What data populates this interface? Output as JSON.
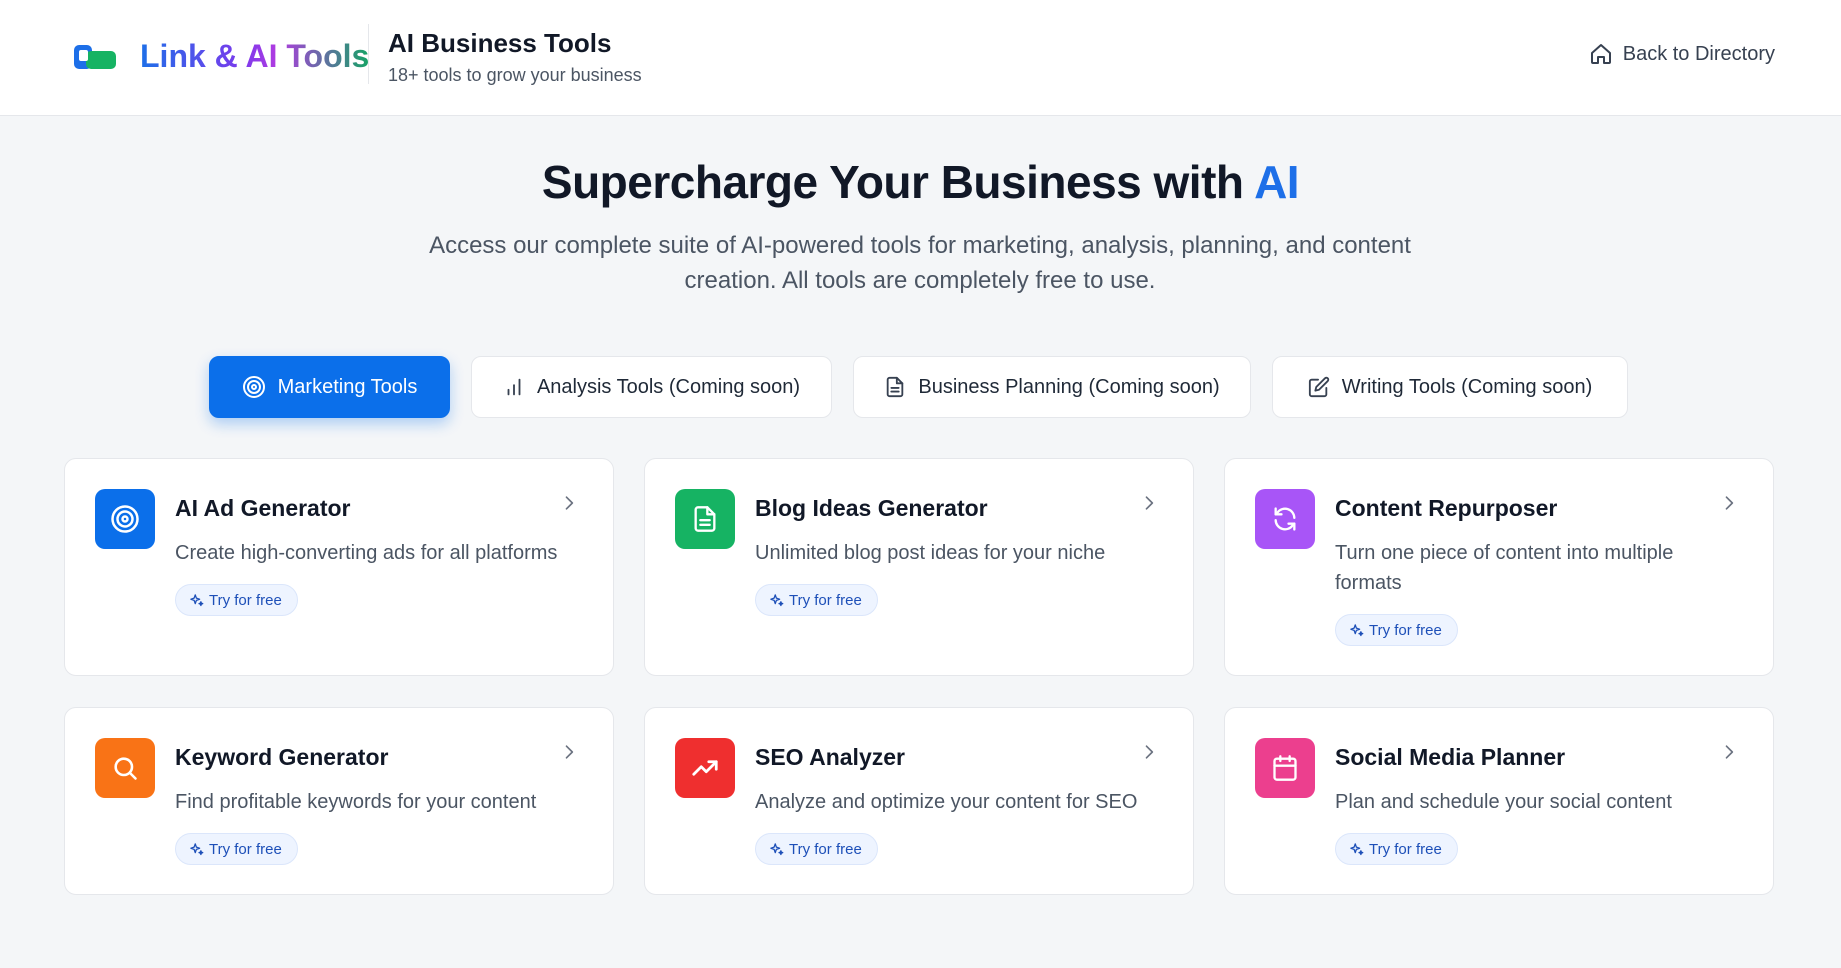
{
  "header": {
    "brand": "Link & AI Tools",
    "title": "AI Business Tools",
    "subtitle": "18+ tools to grow your business",
    "back_label": "Back to Directory"
  },
  "hero": {
    "title_main": "Supercharge Your Business with ",
    "title_accent": "AI",
    "description": "Access our complete suite of AI-powered tools for marketing, analysis, planning, and content creation. All tools are completely free to use."
  },
  "tabs": [
    {
      "label": "Marketing Tools",
      "icon": "target-icon",
      "active": true
    },
    {
      "label": "Analysis Tools (Coming soon)",
      "icon": "bar-chart-icon",
      "active": false
    },
    {
      "label": "Business Planning (Coming soon)",
      "icon": "document-icon",
      "active": false
    },
    {
      "label": "Writing Tools (Coming soon)",
      "icon": "edit-icon",
      "active": false
    }
  ],
  "tools": [
    {
      "title": "AI Ad Generator",
      "description": "Create high-converting ads for all platforms",
      "cta": "Try for free",
      "icon": "target-icon",
      "color": "#0b6fea"
    },
    {
      "title": "Blog Ideas Generator",
      "description": "Unlimited blog post ideas for your niche",
      "cta": "Try for free",
      "icon": "document-icon",
      "color": "#16b363"
    },
    {
      "title": "Content Repurposer",
      "description": "Turn one piece of content into multiple formats",
      "cta": "Try for free",
      "icon": "refresh-icon",
      "color": "#a855f7"
    },
    {
      "title": "Keyword Generator",
      "description": "Find profitable keywords for your content",
      "cta": "Try for free",
      "icon": "search-icon",
      "color": "#f97316"
    },
    {
      "title": "SEO Analyzer",
      "description": "Analyze and optimize your content for SEO",
      "cta": "Try for free",
      "icon": "trending-up-icon",
      "color": "#ef2f2f"
    },
    {
      "title": "Social Media Planner",
      "description": "Plan and schedule your social content",
      "cta": "Try for free",
      "icon": "calendar-icon",
      "color": "#ec3f8e"
    }
  ],
  "colors": {
    "primary": "#0b6fea",
    "background": "#f4f6f8"
  }
}
